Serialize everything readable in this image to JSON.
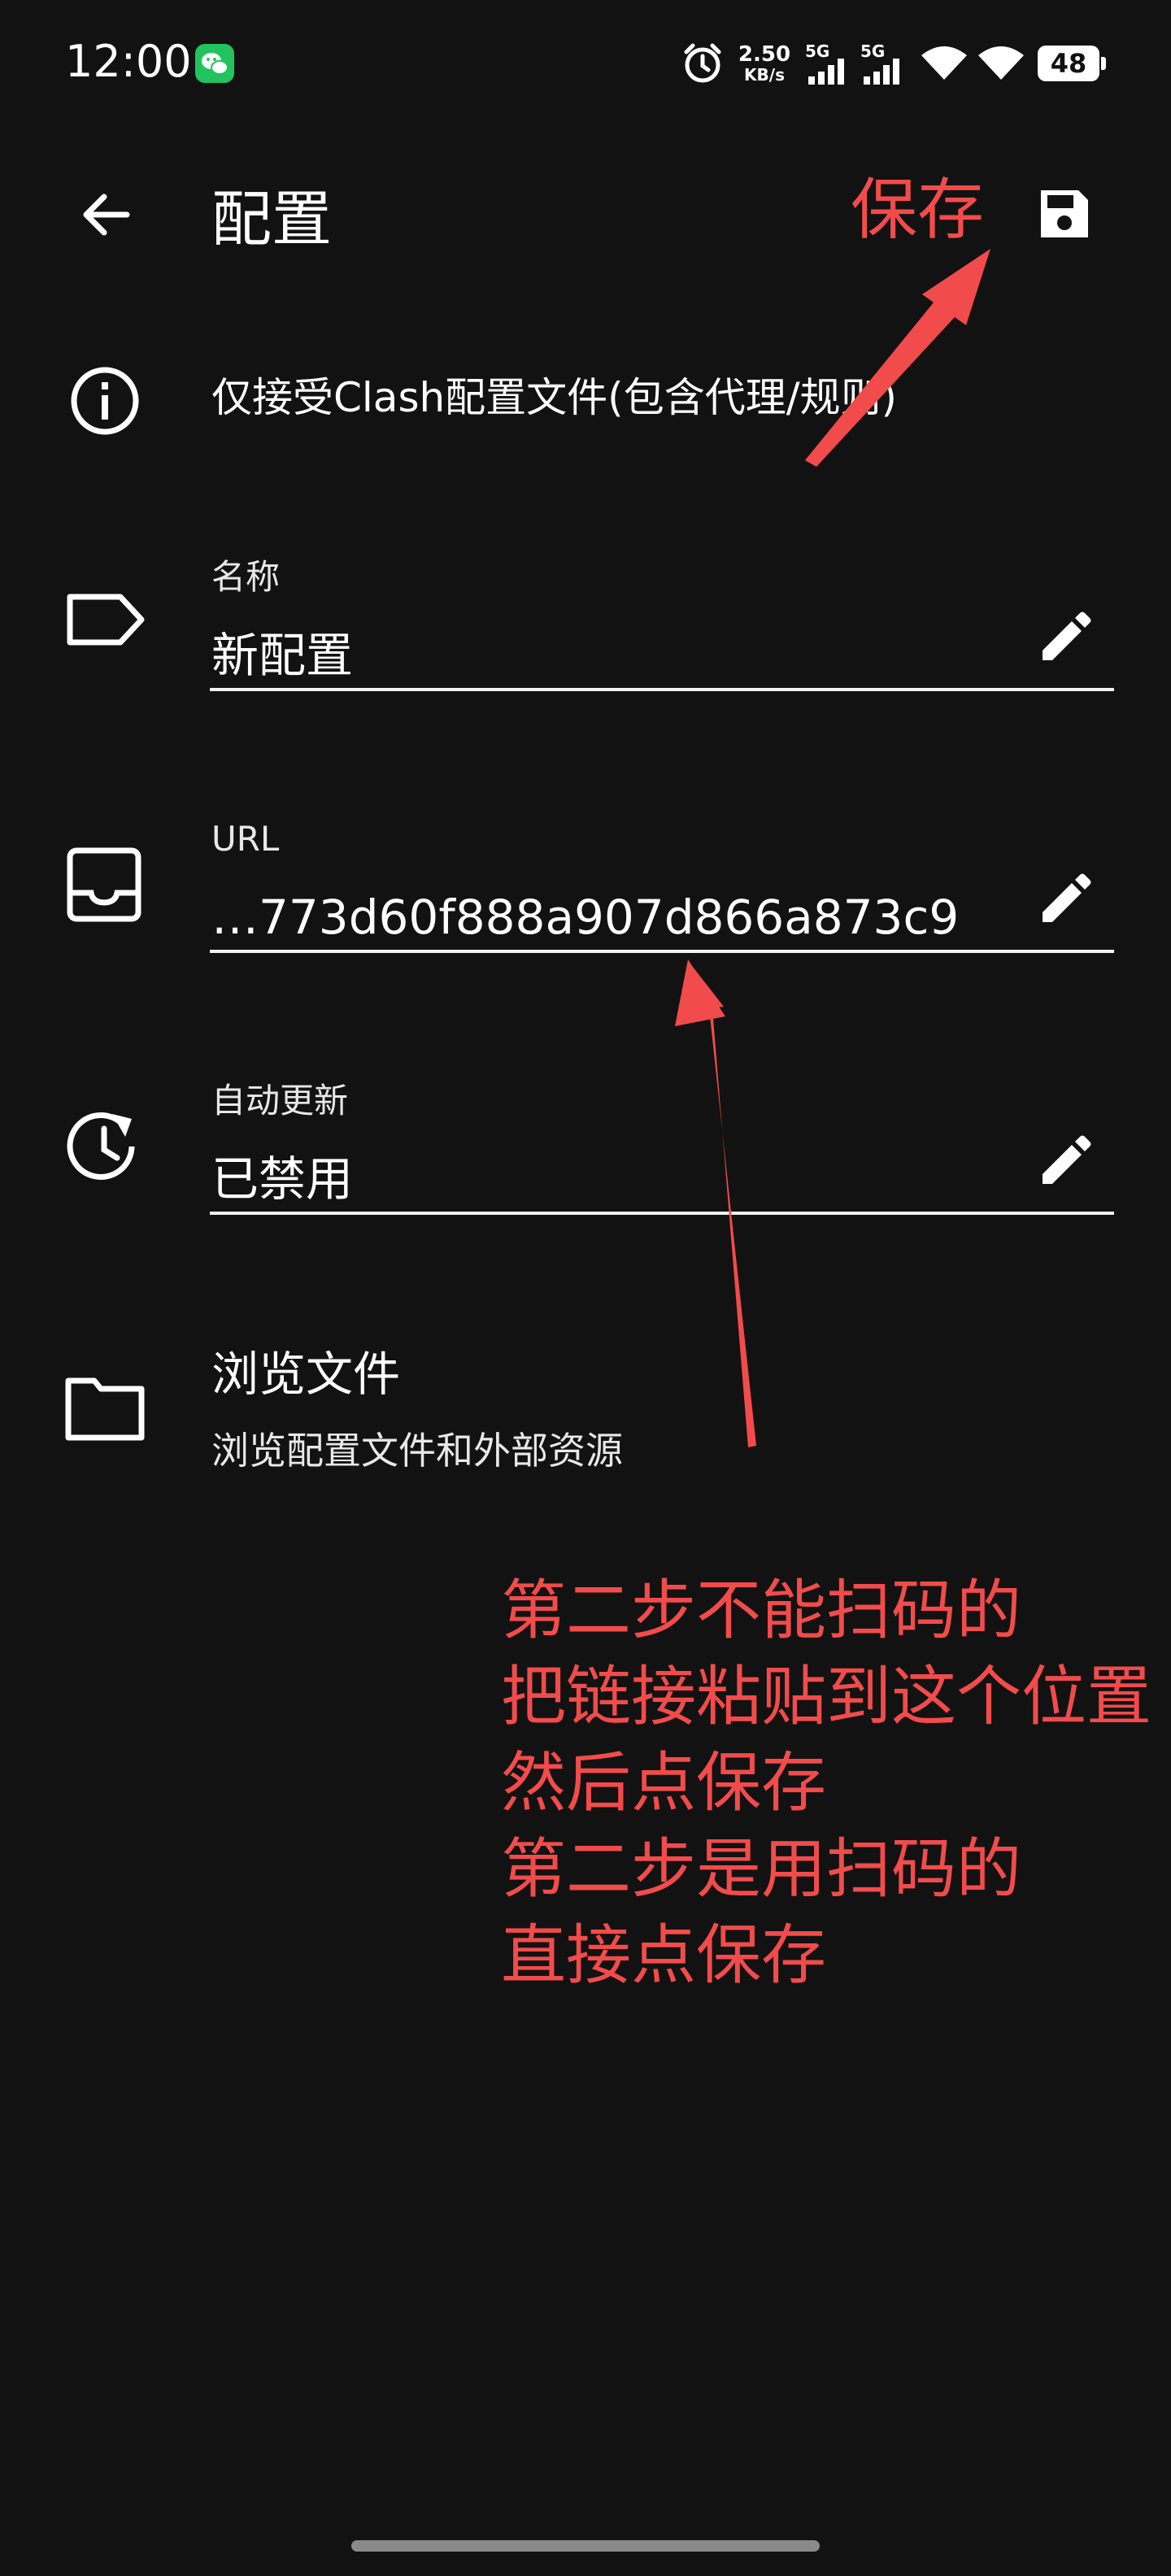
{
  "status_bar": {
    "time": "12:00",
    "net_speed_value": "2.50",
    "net_speed_unit": "KB/s",
    "signal1_label": "5G",
    "signal2_label": "5G",
    "battery": "48"
  },
  "toolbar": {
    "title": "配置"
  },
  "notice": {
    "text": "仅接受Clash配置文件(包含代理/规则)"
  },
  "fields": {
    "name": {
      "label": "名称",
      "value": "新配置"
    },
    "url": {
      "label": "URL",
      "value": "…773d60f888a907d866a873c9"
    },
    "auto_update": {
      "label": "自动更新",
      "value": "已禁用"
    }
  },
  "browse": {
    "title": "浏览文件",
    "subtitle": "浏览配置文件和外部资源"
  },
  "annotations": {
    "save_label": "保存",
    "lines": [
      "第二步不能扫码的",
      "把链接粘贴到这个位置",
      "然后点保存",
      "第二步是用扫码的",
      "直接点保存"
    ],
    "color": "#f24b4b"
  },
  "icons": {
    "back": "back-arrow-icon",
    "save": "save-disk-icon",
    "info": "info-icon",
    "label": "label-tag-icon",
    "url": "inbox-tray-icon",
    "auto_update": "history-clock-icon",
    "browse": "folder-icon",
    "edit": "pencil-edit-icon"
  }
}
